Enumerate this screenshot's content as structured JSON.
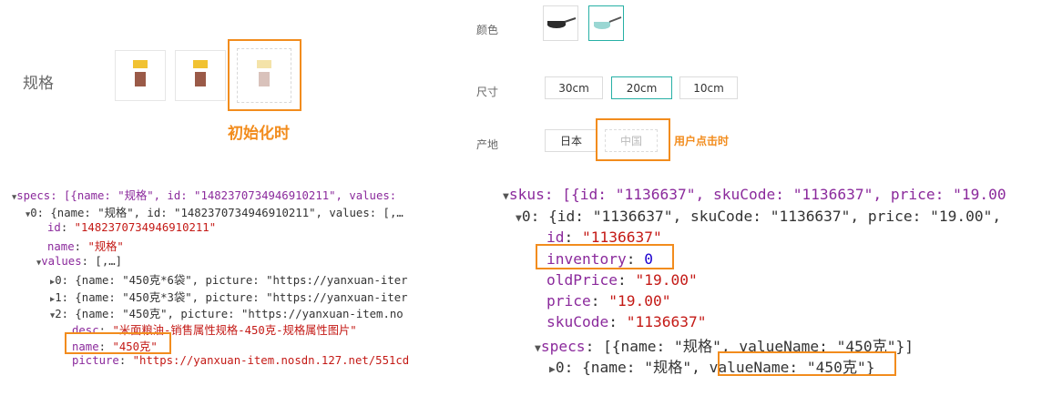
{
  "product_spec": {
    "label": "规格",
    "caption": "初始化时"
  },
  "selector": {
    "color": {
      "label": "颜色"
    },
    "size": {
      "label": "尺寸",
      "options": [
        "30cm",
        "20cm",
        "10cm"
      ]
    },
    "origin": {
      "label": "产地",
      "options": [
        "日本",
        "中国"
      ],
      "caption": "用户点击时"
    }
  },
  "specs_console": {
    "l1": "specs: [{name: \"规格\", id: \"1482370734946910211\", values: ",
    "l2": "0: {name: \"规格\", id: \"1482370734946910211\", values: [,…",
    "l3_key": "id",
    "l3_val": "\"1482370734946910211\"",
    "l4_key": "name",
    "l4_val": "\"规格\"",
    "l5_key": "values",
    "l5_val": "[,…]",
    "l6": "0: {name: \"450克*6袋\", picture: \"https://yanxuan-iter",
    "l7": "1: {name: \"450克*3袋\", picture: \"https://yanxuan-iter",
    "l8": "2: {name: \"450克\", picture: \"https://yanxuan-item.no",
    "l9_key": "desc",
    "l9_val": "\"米面粮油-销售属性规格-450克-规格属性图片\"",
    "l10_key": "name",
    "l10_val": "\"450克\"",
    "l11_key": "picture",
    "l11_val": "\"https://yanxuan-item.nosdn.127.net/551cd"
  },
  "skus_console": {
    "l1": "skus: [{id: \"1136637\", skuCode: \"1136637\", price: \"19.00",
    "l2": "0: {id: \"1136637\", skuCode: \"1136637\", price: \"19.00\",",
    "l3_key": "id",
    "l3_val": "\"1136637\"",
    "l4_key": "inventory",
    "l4_val": "0",
    "l5_key": "oldPrice",
    "l5_val": "\"19.00\"",
    "l6_key": "price",
    "l6_val": "\"19.00\"",
    "l7_key": "skuCode",
    "l7_val": "\"1136637\"",
    "l8_key": "specs",
    "l8_val": "[{name: \"规格\", valueName: \"450克\"}]",
    "l9_a": "0: {name: \"规格\", ",
    "l9_b": "valueName: \"450克\"",
    "l9_c": "}"
  },
  "colors": {
    "highlight": "#f28c1d",
    "selected_border": "#27b0a5",
    "key": "#8b2a9c",
    "string": "#c41a16",
    "number": "#1c00cf"
  }
}
